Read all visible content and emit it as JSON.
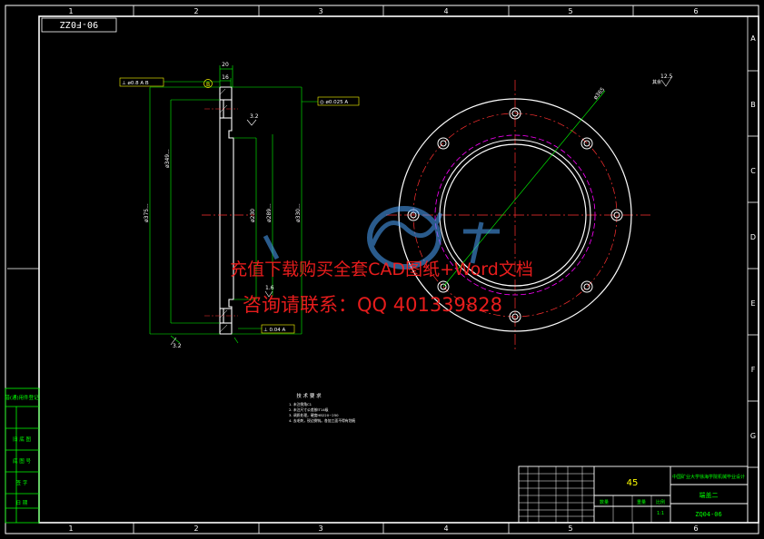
{
  "drawing_code": "90-F0ZZ",
  "grid_cols": [
    "1",
    "2",
    "3",
    "4",
    "5",
    "6"
  ],
  "grid_rows": [
    "A",
    "B",
    "C",
    "D",
    "E",
    "F",
    "G"
  ],
  "side_view": {
    "dim_top_outer": "20",
    "dim_top_inner": "16",
    "datum_B": "B",
    "fcf_parallel": "⊥ ø0.8 A B",
    "fcf_position": "◎ ø0.025 A",
    "fcf_bottom": "⊥ 0.04 A",
    "dim_chamfer_top": "3.2",
    "dim_chamfer_mid": "1.6",
    "dim_chamfer_bot": "3.2",
    "dim_v_375": "ø375...",
    "dim_v_349": "ø349...",
    "dim_v_230": "ø230",
    "dim_v_330": "ø330...",
    "dim_v_289": "ø289..."
  },
  "front_view": {
    "pcd_label": "ø365",
    "roughness": "12.5",
    "roughness_prefix": "其余"
  },
  "watermark": {
    "line1": "充值下载购买全套CAD图纸+Word文档",
    "line2": "咨询请联系：QQ 401339828"
  },
  "tech_notes_title": "技 术 要 求",
  "tech_notes": [
    "1. 未注倒角C1",
    "2. 未注尺寸公差按IT14级",
    "3. 调质处理，硬度HB220~250",
    "4. 去毛刺，锐边倒钝。各加工面不得有划痕"
  ],
  "left_strip": [
    "借(通)用件登记",
    "旧 底 图",
    "底 图 号",
    "签 字",
    "日 期"
  ],
  "title_block": {
    "material": "45",
    "school": "中国矿业大学徐海学院机械毕业设计",
    "part_name": "端盖二",
    "drawing_no": "ZQ04-06",
    "scale_label": "比例",
    "scale": "1:1",
    "count_label": "数量",
    "weight_label": "重量"
  },
  "colors": {
    "frame": "#ffffff",
    "dim": "#00ff00",
    "center": "#ff3030",
    "pcd": "#ff00ff",
    "label": "#ffff00",
    "tb_text": "#00ff00",
    "watermark": "#ff2020"
  }
}
